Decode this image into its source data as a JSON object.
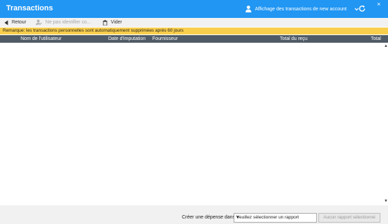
{
  "window": {
    "title": "Transactions",
    "close_glyph": "×"
  },
  "header": {
    "view_label": "Affichage des transactions de new account",
    "view_icon": "user-icon",
    "refresh_icon": "refresh-icon"
  },
  "toolbar": {
    "back_label": "Retour",
    "identify_label": "Ne pas identifier co...",
    "clear_label": "Vider"
  },
  "notice": {
    "text": "Remarque: les transactions personnelles sont automatiquement supprimées après 60 jours",
    "color": "#f8ce4d"
  },
  "table": {
    "columns": [
      "Nom de l'utilisateur",
      "Date d'imputation",
      "Fournisseur",
      "Total du reçu",
      "Total"
    ],
    "rows": []
  },
  "footer": {
    "create_label": "Créer une dépense dans :",
    "report_select_value": "Veuillez sélectionner un rapport",
    "no_report_button": "Aucun rapport sélectionné"
  },
  "colors": {
    "accent": "#2196f3",
    "table_header": "#4f5b66"
  }
}
